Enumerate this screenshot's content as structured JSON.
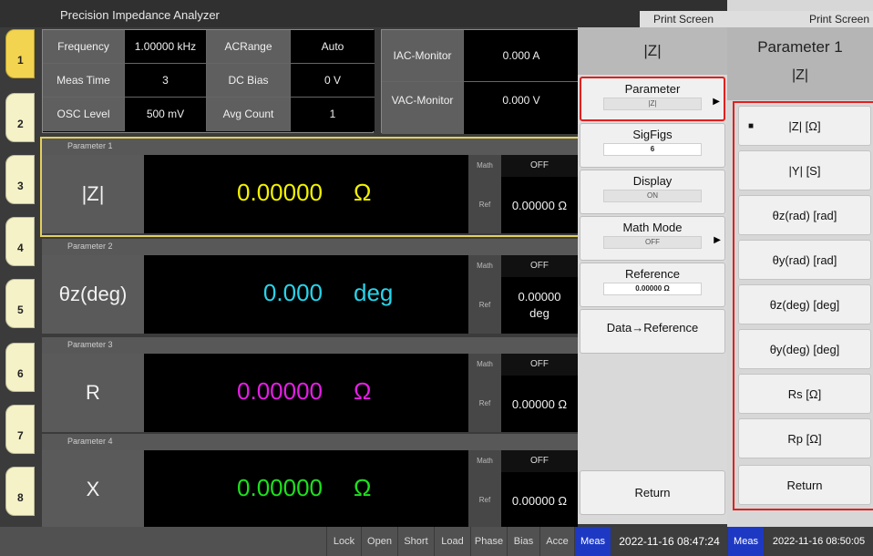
{
  "app": {
    "title": "Precision Impedance Analyzer",
    "print_screen": "Print Screen"
  },
  "channels": [
    "1",
    "2",
    "3",
    "4",
    "5",
    "6",
    "7",
    "8"
  ],
  "settings": {
    "frequency_label": "Frequency",
    "frequency_value": "1.00000 kHz",
    "acrange_label": "ACRange",
    "acrange_value": "Auto",
    "meastime_label": "Meas Time",
    "meastime_value": "3",
    "dcbias_label": "DC Bias",
    "dcbias_value": "0 V",
    "osclevel_label": "OSC Level",
    "osclevel_value": "500 mV",
    "avgcount_label": "Avg Count",
    "avgcount_value": "1"
  },
  "monitor": {
    "iac_label": "IAC-Monitor",
    "iac_value": "0.000 A",
    "vac_label": "VAC-Monitor",
    "vac_value": "0.000 V"
  },
  "parameters": [
    {
      "header": "Parameter 1",
      "name": "|Z|",
      "value": "0.00000",
      "unit": "Ω",
      "color": "#f2f200",
      "math_label": "Math",
      "math_value": "OFF",
      "ref_label": "Ref",
      "ref_value": "0.00000 Ω"
    },
    {
      "header": "Parameter 2",
      "name": "θz(deg)",
      "value": "0.000",
      "unit": "deg",
      "color": "#27d4ea",
      "math_label": "Math",
      "math_value": "OFF",
      "ref_label": "Ref",
      "ref_value": "0.00000\ndeg"
    },
    {
      "header": "Parameter 3",
      "name": "R",
      "value": "0.00000",
      "unit": "Ω",
      "color": "#e51ee5",
      "math_label": "Math",
      "math_value": "OFF",
      "ref_label": "Ref",
      "ref_value": "0.00000 Ω"
    },
    {
      "header": "Parameter 4",
      "name": "X",
      "value": "0.00000",
      "unit": "Ω",
      "color": "#1de01d",
      "math_label": "Math",
      "math_value": "OFF",
      "ref_label": "Ref",
      "ref_value": "0.00000 Ω"
    }
  ],
  "softkeys": {
    "header": "|Z|",
    "parameter_label": "Parameter",
    "parameter_value": "|Z|",
    "sigfigs_label": "SigFigs",
    "sigfigs_value": "6",
    "display_label": "Display",
    "display_value": "ON",
    "mathmode_label": "Math Mode",
    "mathmode_value": "OFF",
    "reference_label": "Reference",
    "reference_value": "0.00000 Ω",
    "data_reference_label": "Data→Reference",
    "return_label": "Return"
  },
  "statusbar": {
    "items": [
      "Lock",
      "Open",
      "Short",
      "Load",
      "Phase",
      "Bias",
      "Acce"
    ],
    "meas": "Meas",
    "time": "2022-11-16 08:47:24"
  },
  "param_menu": {
    "title": "Parameter 1",
    "subtitle": "|Z|",
    "options": [
      "|Z| [Ω]",
      "|Y| [S]",
      "θz(rad) [rad]",
      "θy(rad) [rad]",
      "θz(deg) [deg]",
      "θy(deg) [deg]",
      "Rs [Ω]",
      "Rp [Ω]"
    ],
    "selected_marker": "■",
    "return_label": "Return",
    "meas": "Meas",
    "time": "2022-11-16 08:50:05"
  }
}
